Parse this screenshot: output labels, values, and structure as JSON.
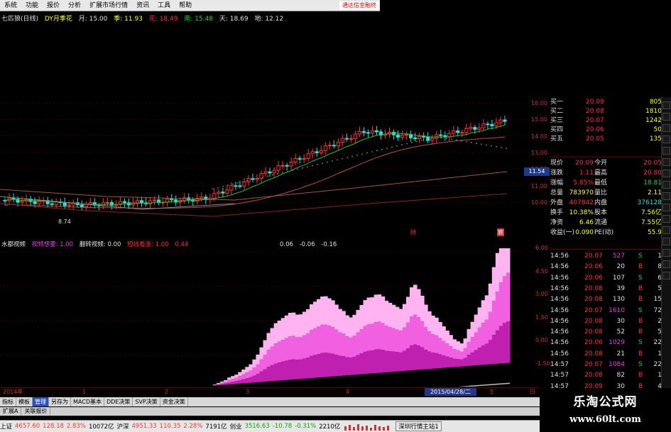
{
  "menu": {
    "items": [
      "系统",
      "功能",
      "报价",
      "分析",
      "扩展市场行情",
      "资讯",
      "工具",
      "帮助"
    ],
    "ad": "通达信金融终"
  },
  "topinfo": {
    "title": "七匹狼(日线)",
    "indicator": "DY月季花",
    "ma_month": "月: 15.00",
    "ma_season": "季: 11.93",
    "ma_flower": "花: 18.49",
    "ma_south": "南: 15.48",
    "ma_sky": "天: 18.69",
    "ma_earth": "地: 12.12"
  },
  "yaxis_main": [
    "16.00",
    "15.00",
    "14.00",
    "13.00",
    "12.00",
    "11.00",
    "10.00"
  ],
  "price_box": "11.54",
  "chart_markers": {
    "marker_a": "财",
    "marker_b": "宸",
    "low_label": "8.74"
  },
  "indicator_header": {
    "name": "水都视频",
    "l1": "视频想要: 1.00",
    "l2": "翻转视频: 0.00",
    "l3": "短线看涨: 1.00",
    "l4": "0.44",
    "l5": "0.06",
    "l6": "-0.06",
    "l7": "-0.16"
  },
  "yaxis_sub": [
    "6.00",
    "4.50",
    "3.00",
    "1.50",
    "0.00",
    "-1.50"
  ],
  "xaxis": {
    "labels": [
      "2014年",
      "1",
      "2",
      "3",
      "4",
      "5",
      "6",
      "日"
    ],
    "date": "2015/04/28/二"
  },
  "tabs": [
    "指标",
    "模板",
    "管理",
    "另存为",
    "MACD基本",
    "DDE决策",
    "SVP决策",
    "资金决策"
  ],
  "tabs_active": 2,
  "tabs2": [
    "扩展A",
    "关联报价"
  ],
  "quote": {
    "orders": [
      {
        "label": "买一",
        "price": "20.09",
        "vol": "805"
      },
      {
        "label": "买二",
        "price": "20.08",
        "vol": "1810"
      },
      {
        "label": "买三",
        "price": "20.07",
        "vol": "1242"
      },
      {
        "label": "买四",
        "price": "20.06",
        "vol": "50"
      },
      {
        "label": "买五",
        "price": "20.05",
        "vol": "135"
      }
    ],
    "stats": [
      {
        "l": "现价",
        "v": "20.09",
        "l2": "今开",
        "v2": "20.05"
      },
      {
        "l": "涨跌",
        "v": "1.11",
        "l2": "最高",
        "v2": "20.80"
      },
      {
        "l": "涨幅",
        "v": "5.85%",
        "l2": "最低",
        "v2": "18.81"
      },
      {
        "l": "总量",
        "v": "783970",
        "l2": "量比",
        "v2": "2.11"
      },
      {
        "l": "外盘",
        "v": "407842",
        "l2": "内盘",
        "v2": "376128"
      },
      {
        "l": "换手",
        "v": "10.38%",
        "l2": "股本",
        "v2": "7.56亿"
      },
      {
        "l": "净资",
        "v": "6.46",
        "l2": "流通",
        "v2": "7.55亿"
      },
      {
        "l": "收益(一)",
        "v": "0.090",
        "l2": "PE(动)",
        "v2": "55.9"
      }
    ],
    "ticks": [
      {
        "t": "14:56",
        "p": "20.07",
        "v": "527",
        "d": "S",
        "x": "1"
      },
      {
        "t": "14:56",
        "p": "20.06",
        "v": "20",
        "d": "B",
        "x": "8"
      },
      {
        "t": "14:56",
        "p": "20.06",
        "v": "107",
        "d": "S",
        "x": "6"
      },
      {
        "t": "14:56",
        "p": "20.08",
        "v": "39",
        "d": "B",
        "x": "5"
      },
      {
        "t": "14:56",
        "p": "20.08",
        "v": "130",
        "d": "B",
        "x": "15"
      },
      {
        "t": "14:56",
        "p": "20.07",
        "v": "1610",
        "d": "S",
        "x": "72"
      },
      {
        "t": "14:56",
        "p": "20.08",
        "v": "30",
        "d": "B",
        "x": "2"
      },
      {
        "t": "14:56",
        "p": "20.08",
        "v": "52",
        "d": "B",
        "x": "5"
      },
      {
        "t": "14:56",
        "p": "20.06",
        "v": "1029",
        "d": "S",
        "x": "22"
      },
      {
        "t": "14:56",
        "p": "20.08",
        "v": "21",
        "d": "B",
        "x": "1"
      },
      {
        "t": "14:57",
        "p": "20.07",
        "v": "1084",
        "d": "S",
        "x": "22"
      },
      {
        "t": "14:57",
        "p": "20.08",
        "v": "82",
        "d": "B",
        "x": "1"
      },
      {
        "t": "14:57",
        "p": "20.09",
        "v": "30",
        "d": "B",
        "x": "4"
      }
    ]
  },
  "status": {
    "sh": "上证",
    "sh_val": "4657.60",
    "sh_chg": "128.18",
    "sh_pct": "2.83%",
    "sh_amt": "10072亿",
    "hs": "沪深",
    "hs_val": "4951.33",
    "hs_chg": "110.35",
    "hs_pct": "2.28%",
    "hs_amt": "7191亿",
    "cy": "创业",
    "cy_val": "3516.63",
    "cy_chg": "-10.78",
    "cy_pct": "-0.31%",
    "cy_amt": "2210亿",
    "site": "深圳行情主站1"
  },
  "watermark": {
    "line1": "乐淘公式网",
    "line2": "www.60lt.com"
  },
  "colors": {
    "up": "#ff3333",
    "down": "#33dddd",
    "ma_green": "#22c722",
    "ma_brown": "#b4553a",
    "ma_gray": "#888888"
  }
}
